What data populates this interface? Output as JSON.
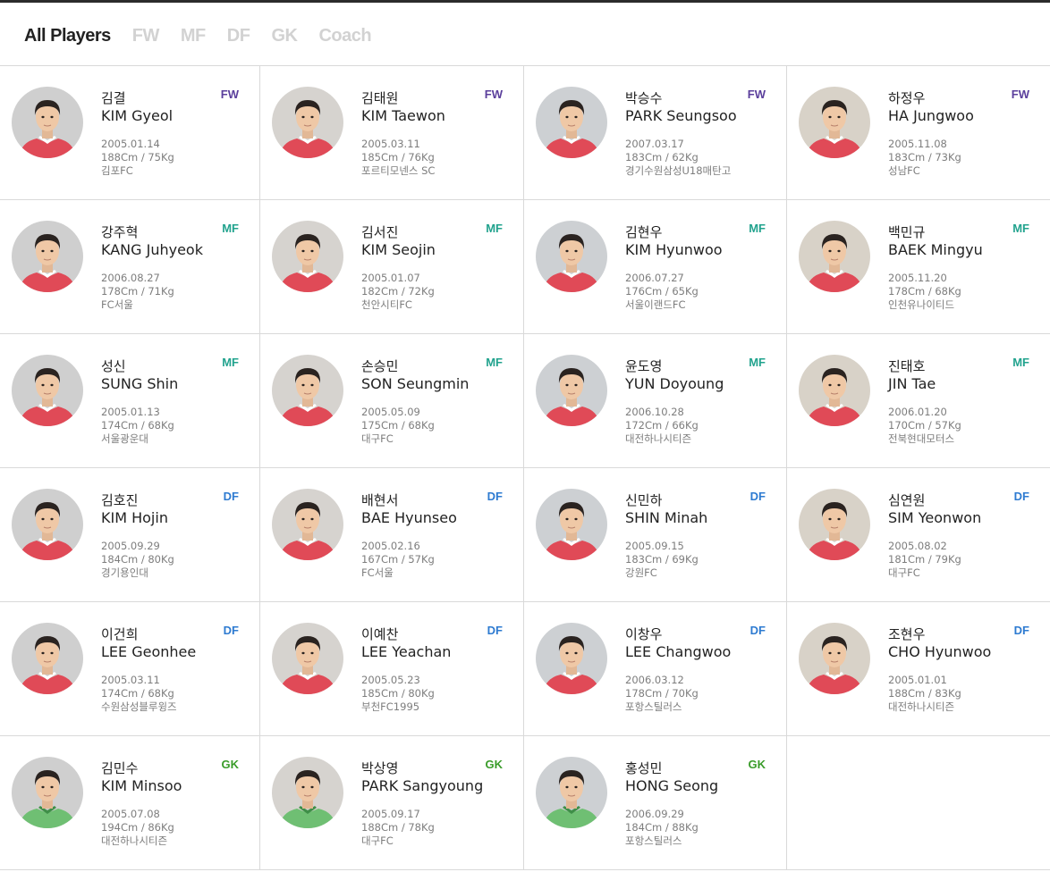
{
  "tabs": [
    {
      "label": "All Players",
      "active": true
    },
    {
      "label": "FW",
      "active": false
    },
    {
      "label": "MF",
      "active": false
    },
    {
      "label": "DF",
      "active": false
    },
    {
      "label": "GK",
      "active": false
    },
    {
      "label": "Coach",
      "active": false
    }
  ],
  "position_colors": {
    "FW": "#5b3f9c",
    "MF": "#22a38e",
    "DF": "#2e7bd1",
    "GK": "#3a9c2a"
  },
  "players": [
    {
      "kname": "김결",
      "ename": "KIM Gyeol",
      "pos": "FW",
      "birth": "2005.01.14",
      "body": "188Cm / 75Kg",
      "club": "김포FC",
      "kit": "red"
    },
    {
      "kname": "김태원",
      "ename": "KIM Taewon",
      "pos": "FW",
      "birth": "2005.03.11",
      "body": "185Cm / 76Kg",
      "club": "포르티모넨스 SC",
      "kit": "red"
    },
    {
      "kname": "박승수",
      "ename": "PARK Seungsoo",
      "pos": "FW",
      "birth": "2007.03.17",
      "body": "183Cm / 62Kg",
      "club": "경기수원삼성U18매탄고",
      "kit": "red"
    },
    {
      "kname": "하정우",
      "ename": "HA Jungwoo",
      "pos": "FW",
      "birth": "2005.11.08",
      "body": "183Cm / 73Kg",
      "club": "성남FC",
      "kit": "red"
    },
    {
      "kname": "강주혁",
      "ename": "KANG Juhyeok",
      "pos": "MF",
      "birth": "2006.08.27",
      "body": "178Cm / 71Kg",
      "club": "FC서울",
      "kit": "red"
    },
    {
      "kname": "김서진",
      "ename": "KIM Seojin",
      "pos": "MF",
      "birth": "2005.01.07",
      "body": "182Cm / 72Kg",
      "club": "천안시티FC",
      "kit": "red"
    },
    {
      "kname": "김현우",
      "ename": "KIM Hyunwoo",
      "pos": "MF",
      "birth": "2006.07.27",
      "body": "176Cm / 65Kg",
      "club": "서울이랜드FC",
      "kit": "red"
    },
    {
      "kname": "백민규",
      "ename": "BAEK Mingyu",
      "pos": "MF",
      "birth": "2005.11.20",
      "body": "178Cm / 68Kg",
      "club": "인천유나이티드",
      "kit": "red"
    },
    {
      "kname": "성신",
      "ename": "SUNG Shin",
      "pos": "MF",
      "birth": "2005.01.13",
      "body": "174Cm / 68Kg",
      "club": "서울광운대",
      "kit": "red"
    },
    {
      "kname": "손승민",
      "ename": "SON Seungmin",
      "pos": "MF",
      "birth": "2005.05.09",
      "body": "175Cm / 68Kg",
      "club": "대구FC",
      "kit": "red"
    },
    {
      "kname": "윤도영",
      "ename": "YUN Doyoung",
      "pos": "MF",
      "birth": "2006.10.28",
      "body": "172Cm / 66Kg",
      "club": "대전하나시티즌",
      "kit": "red"
    },
    {
      "kname": "진태호",
      "ename": "JIN Tae",
      "pos": "MF",
      "birth": "2006.01.20",
      "body": "170Cm / 57Kg",
      "club": "전북현대모터스",
      "kit": "red"
    },
    {
      "kname": "김호진",
      "ename": "KIM Hojin",
      "pos": "DF",
      "birth": "2005.09.29",
      "body": "184Cm / 80Kg",
      "club": "경기용인대",
      "kit": "red"
    },
    {
      "kname": "배현서",
      "ename": "BAE Hyunseo",
      "pos": "DF",
      "birth": "2005.02.16",
      "body": "167Cm / 57Kg",
      "club": "FC서울",
      "kit": "red"
    },
    {
      "kname": "신민하",
      "ename": "SHIN Minah",
      "pos": "DF",
      "birth": "2005.09.15",
      "body": "183Cm / 69Kg",
      "club": "강원FC",
      "kit": "red"
    },
    {
      "kname": "심연원",
      "ename": "SIM Yeonwon",
      "pos": "DF",
      "birth": "2005.08.02",
      "body": "181Cm / 79Kg",
      "club": "대구FC",
      "kit": "red"
    },
    {
      "kname": "이건희",
      "ename": "LEE Geonhee",
      "pos": "DF",
      "birth": "2005.03.11",
      "body": "174Cm / 68Kg",
      "club": "수원삼성블루윙즈",
      "kit": "red"
    },
    {
      "kname": "이예찬",
      "ename": "LEE Yeachan",
      "pos": "DF",
      "birth": "2005.05.23",
      "body": "185Cm / 80Kg",
      "club": "부천FC1995",
      "kit": "red"
    },
    {
      "kname": "이창우",
      "ename": "LEE Changwoo",
      "pos": "DF",
      "birth": "2006.03.12",
      "body": "178Cm / 70Kg",
      "club": "포항스틸러스",
      "kit": "red"
    },
    {
      "kname": "조현우",
      "ename": "CHO Hyunwoo",
      "pos": "DF",
      "birth": "2005.01.01",
      "body": "188Cm / 83Kg",
      "club": "대전하나시티즌",
      "kit": "red"
    },
    {
      "kname": "김민수",
      "ename": "KIM Minsoo",
      "pos": "GK",
      "birth": "2005.07.08",
      "body": "194Cm / 86Kg",
      "club": "대전하나시티즌",
      "kit": "green"
    },
    {
      "kname": "박상영",
      "ename": "PARK Sangyoung",
      "pos": "GK",
      "birth": "2005.09.17",
      "body": "188Cm / 78Kg",
      "club": "대구FC",
      "kit": "green"
    },
    {
      "kname": "홍성민",
      "ename": "HONG Seong",
      "pos": "GK",
      "birth": "2006.09.29",
      "body": "184Cm / 88Kg",
      "club": "포항스틸러스",
      "kit": "green"
    }
  ]
}
